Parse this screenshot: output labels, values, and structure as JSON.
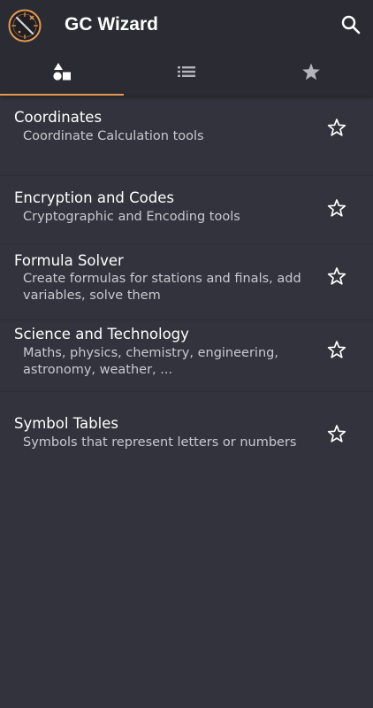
{
  "app": {
    "title": "GC Wizard",
    "logo_icon": "gc-wizard-compass-logo",
    "search_icon": "search-icon"
  },
  "tabs": [
    {
      "icon": "shapes-icon",
      "selected": true
    },
    {
      "icon": "list-icon",
      "selected": false
    },
    {
      "icon": "star-filled-icon",
      "selected": false
    }
  ],
  "categories": [
    {
      "title": "Coordinates",
      "subtitle": "Coordinate Calculation tools"
    },
    {
      "title": "Encryption and Codes",
      "subtitle": "Cryptographic and Encoding tools"
    },
    {
      "title": "Formula Solver",
      "subtitle": "Create formulas for stations and finals, add variables, solve them"
    },
    {
      "title": "Science and Technology",
      "subtitle": "Maths, physics, chemistry, engineering, astronomy, weather, ..."
    },
    {
      "title": "Symbol Tables",
      "subtitle": "Symbols that represent letters or numbers"
    }
  ],
  "colors": {
    "background": "#33333d",
    "appbar": "#2b2b33",
    "accent": "#e39a4f",
    "text_primary": "#ffffff",
    "text_secondary": "#c9c9cf"
  }
}
